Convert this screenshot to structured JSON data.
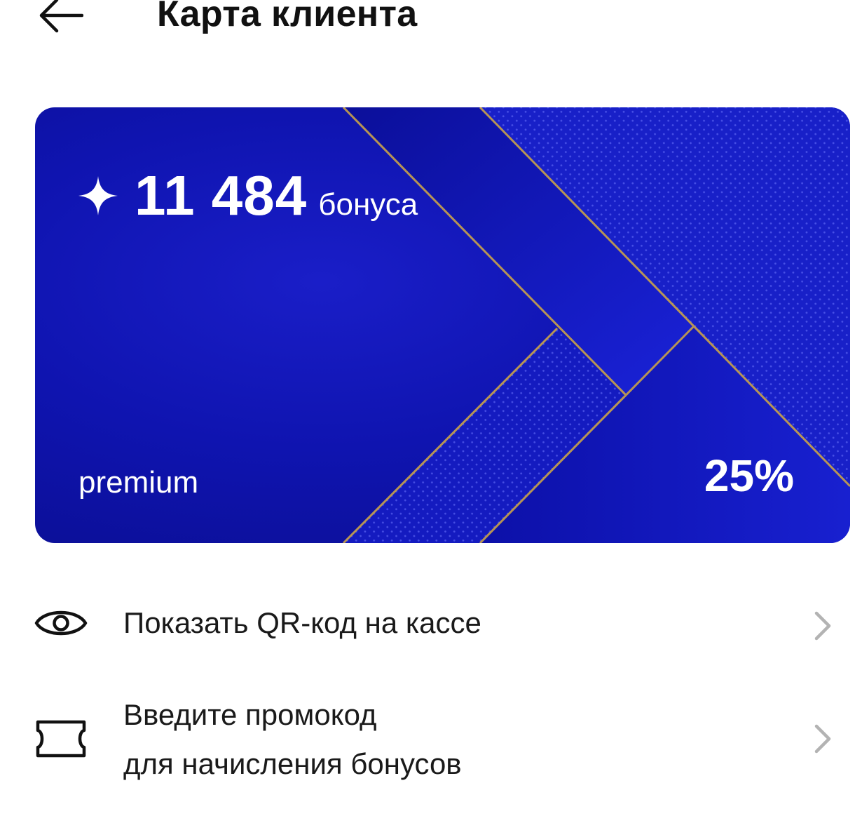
{
  "header": {
    "title": "Карта клиента",
    "back_icon": "arrow-left-icon"
  },
  "card": {
    "bonus_icon": "sparkle-star-icon",
    "bonus_amount": "11 484",
    "bonus_unit": "бонуса",
    "tier": "premium",
    "discount": "25%",
    "colors": {
      "background": "#1014b4",
      "accent_lines": "#c9a24a"
    }
  },
  "menu": {
    "qr": {
      "icon": "eye-icon",
      "label": "Показать QR-код на кассе"
    },
    "promo": {
      "icon": "ticket-icon",
      "label_line1": "Введите промокод",
      "label_line2": "для начисления бонусов"
    },
    "chevron_icon": "chevron-right-icon"
  }
}
